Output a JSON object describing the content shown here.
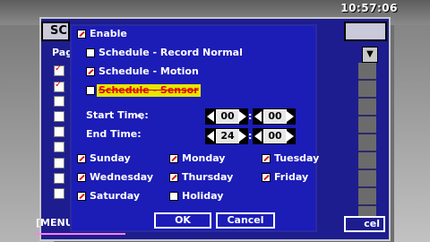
{
  "clock": "10:57:06",
  "background_window": {
    "title_fragment": "SC",
    "page_fragment": "Pag",
    "menu_label": "[MENU",
    "cancel_fragment": "cel"
  },
  "dialog": {
    "enable": {
      "label": "Enable",
      "checked": true
    },
    "schedules": [
      {
        "label": "Schedule - Record Normal",
        "checked": false,
        "highlighted": false
      },
      {
        "label": "Schedule - Motion",
        "checked": true,
        "highlighted": false
      },
      {
        "label": "Schedule - Sensor",
        "checked": false,
        "highlighted": true
      }
    ],
    "start_time": {
      "label": "Start Time:",
      "hour": "00",
      "minute": "00"
    },
    "end_time": {
      "label": "End Time:",
      "hour": "24",
      "minute": "00"
    },
    "days": [
      {
        "label": "Sunday",
        "checked": true
      },
      {
        "label": "Monday",
        "checked": true
      },
      {
        "label": "Tuesday",
        "checked": true
      },
      {
        "label": "Wednesday",
        "checked": true
      },
      {
        "label": "Thursday",
        "checked": true
      },
      {
        "label": "Friday",
        "checked": true
      },
      {
        "label": "Saturday",
        "checked": true
      },
      {
        "label": "Holiday",
        "checked": false
      }
    ],
    "ok_label": "OK",
    "cancel_label": "Cancel"
  },
  "colors": {
    "dialog_bg": "#1c1cb7",
    "highlight": "#e6e600",
    "check_mark": "#e01010"
  }
}
